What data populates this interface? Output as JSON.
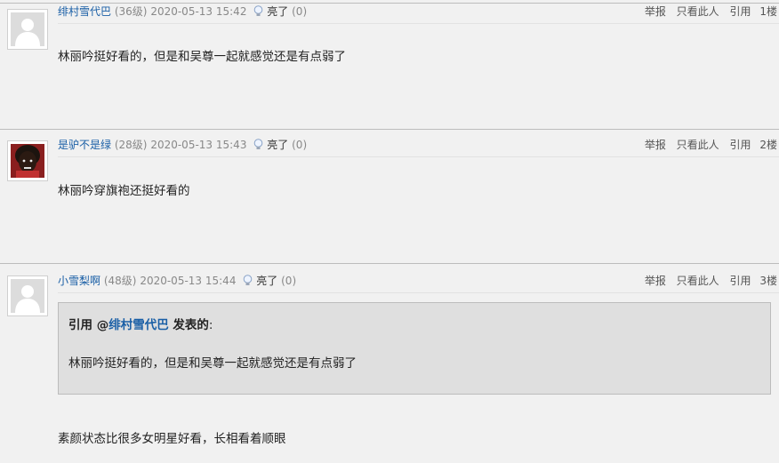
{
  "posts": [
    {
      "user": "绯村雪代巴",
      "level": "(36级)",
      "time": "2020-05-13 15:42",
      "like_label": "亮了",
      "like_count": "(0)",
      "report": "举报",
      "only_this": "只看此人",
      "quote": "引用",
      "floor": "1楼",
      "content": "林丽吟挺好看的，但是和吴尊一起就感觉还是有点弱了"
    },
    {
      "user": "是驴不是绿",
      "level": "(28级)",
      "time": "2020-05-13 15:43",
      "like_label": "亮了",
      "like_count": "(0)",
      "report": "举报",
      "only_this": "只看此人",
      "quote": "引用",
      "floor": "2楼",
      "content": "林丽吟穿旗袍还挺好看的"
    },
    {
      "user": "小雪梨啊",
      "level": "(48级)",
      "time": "2020-05-13 15:44",
      "like_label": "亮了",
      "like_count": "(0)",
      "report": "举报",
      "only_this": "只看此人",
      "quote": "引用",
      "floor": "3楼",
      "quote_box": {
        "prefix": "引用 @",
        "user": "绯村雪代巴",
        "suffix": " 发表的",
        "colon": ":",
        "text": "林丽吟挺好看的，但是和吴尊一起就感觉还是有点弱了"
      },
      "content": "素颜状态比很多女明星好看，长相看着顺眼"
    }
  ]
}
